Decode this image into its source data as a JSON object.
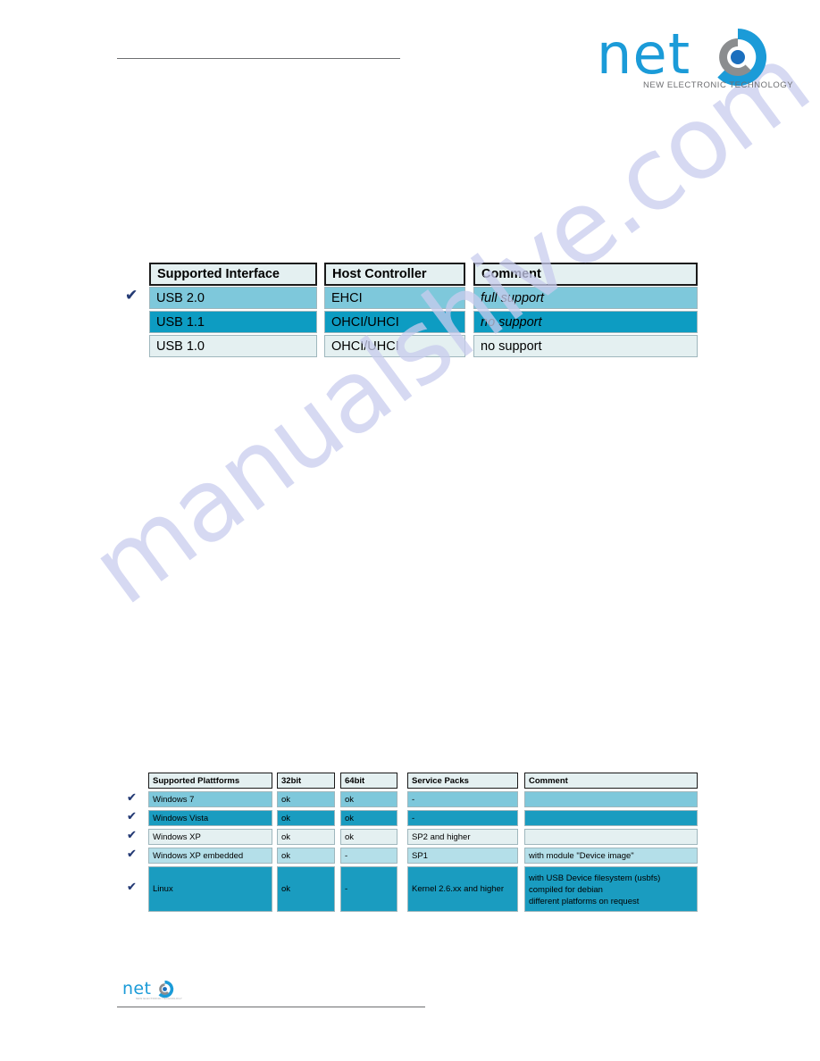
{
  "brand": {
    "logo_word": "net",
    "tagline": "NEW ELECTRONIC TECHNOLOGY",
    "footer_logo_word": "net",
    "footer_tagline": "NEW ELECTRONIC TECHNOLOGY",
    "accent_color": "#1b9bd8",
    "lens_gray": "#8b8d8f"
  },
  "watermark": {
    "text": "manualshive.com",
    "color": "#c9cdee"
  },
  "interface_table": {
    "headers": [
      "Supported Interface",
      "Host Controller",
      "Comment"
    ],
    "rows": [
      {
        "interface": "USB 2.0",
        "controller": "EHCI",
        "comment": "full support",
        "comment_italic": true,
        "checked": true,
        "row_color": "#7ec8db"
      },
      {
        "interface": "USB 1.1",
        "controller": "OHCI/UHCI",
        "comment": "no support",
        "comment_italic": true,
        "checked": false,
        "row_color": "#0d9cc2"
      },
      {
        "interface": "USB 1.0",
        "controller": "OHCI/UHCI",
        "comment": "no support",
        "comment_italic": false,
        "checked": false,
        "row_color": "#e4f0f1"
      }
    ]
  },
  "platform_table": {
    "headers": [
      "Supported Plattforms",
      "32bit",
      "64bit",
      "Service Packs",
      "Comment"
    ],
    "rows": [
      {
        "platform": "Windows 7",
        "bit32": "ok",
        "bit64": "ok",
        "service_packs": "-",
        "comment": "",
        "checked": true,
        "row_color": "#7ec8db"
      },
      {
        "platform": "Windows Vista",
        "bit32": "ok",
        "bit64": "ok",
        "service_packs": "-",
        "comment": "",
        "checked": true,
        "row_color": "#1a9cc0"
      },
      {
        "platform": "Windows XP",
        "bit32": "ok",
        "bit64": "ok",
        "service_packs": "SP2 and higher",
        "comment": "",
        "checked": true,
        "row_color": "#e4f0f1"
      },
      {
        "platform": "Windows XP embedded",
        "bit32": "ok",
        "bit64": "-",
        "service_packs": "SP1",
        "comment": "with module \"Device image\"",
        "checked": true,
        "row_color": "#b4dfe9"
      },
      {
        "platform": "Linux",
        "bit32": "ok",
        "bit64": "-",
        "service_packs": "Kernel 2.6.xx and higher",
        "comment_lines": [
          "with USB Device filesystem (usbfs)",
          "compiled for debian",
          "different platforms on request"
        ],
        "checked": true,
        "row_color": "#1a9cc0"
      }
    ]
  },
  "icons": {
    "check": "✔"
  }
}
